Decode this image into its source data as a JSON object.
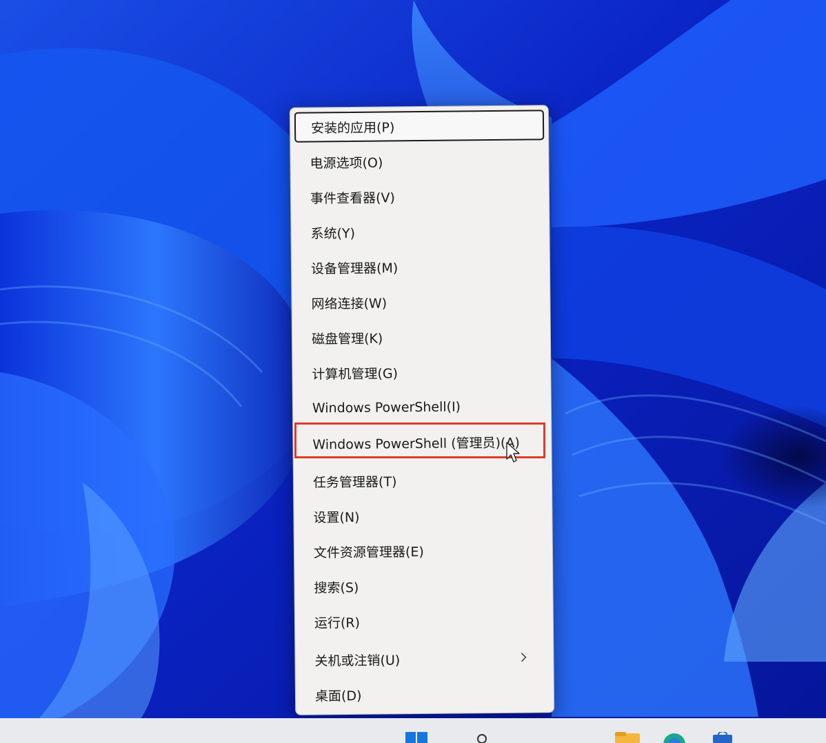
{
  "menu": {
    "items": [
      {
        "label": "安装的应用(P)"
      },
      {
        "label": "电源选项(O)"
      },
      {
        "label": "事件查看器(V)"
      },
      {
        "label": "系统(Y)"
      },
      {
        "label": "设备管理器(M)"
      },
      {
        "label": "网络连接(W)"
      },
      {
        "label": "磁盘管理(K)"
      },
      {
        "label": "计算机管理(G)"
      },
      {
        "label": "Windows PowerShell(I)"
      },
      {
        "label": "Windows PowerShell (管理员)(A)"
      },
      {
        "label": "任务管理器(T)"
      },
      {
        "label": "设置(N)"
      },
      {
        "label": "文件资源管理器(E)"
      },
      {
        "label": "搜索(S)"
      },
      {
        "label": "运行(R)"
      },
      {
        "label": "关机或注销(U)"
      },
      {
        "label": "桌面(D)"
      }
    ],
    "focused_item": "安装的应用(P)",
    "highlighted_item": "Windows PowerShell (管理员)(A)",
    "submenu_icon": "chevron-right-icon"
  },
  "taskbar": {
    "icons": [
      "windows-start-icon",
      "search-icon",
      "file-explorer-icon",
      "edge-browser-icon",
      "store-icon"
    ]
  },
  "colors": {
    "highlight_border": "#e03a2b",
    "menu_background": "#f2f1f0",
    "wallpaper_blue": "#0b2bc8"
  }
}
